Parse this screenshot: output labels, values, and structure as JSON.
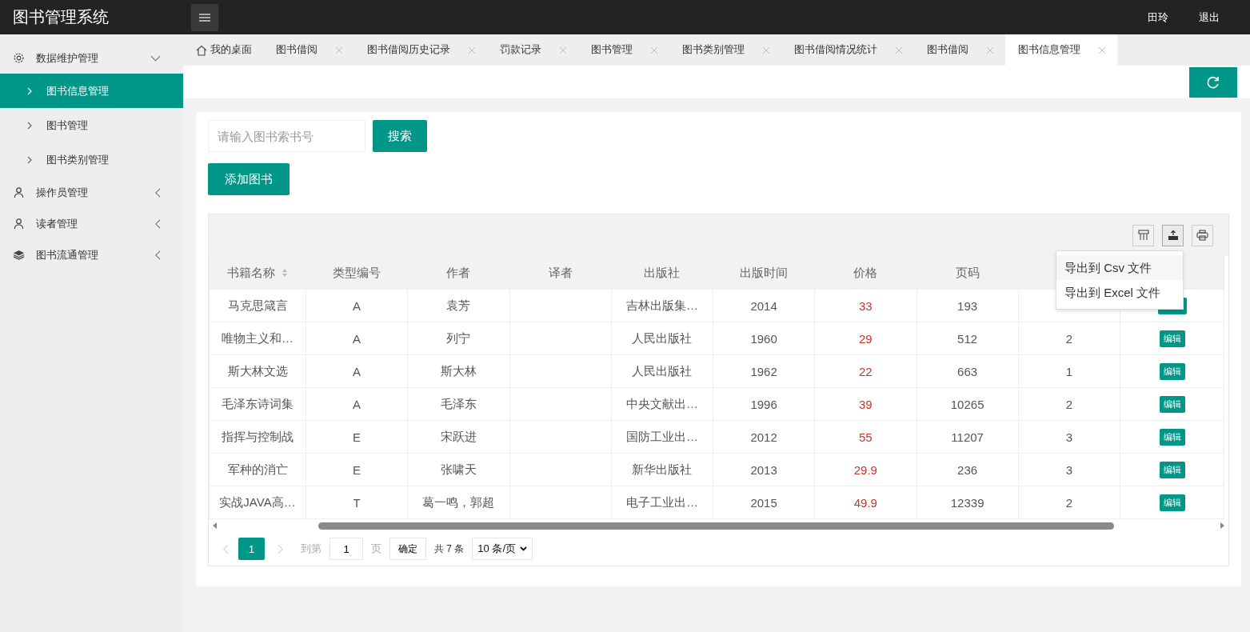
{
  "header": {
    "title": "图书管理系统",
    "user": "田玲",
    "logout": "退出"
  },
  "sidebar": {
    "items": [
      {
        "label": "数据维护管理",
        "expanded": true,
        "children": [
          {
            "label": "图书信息管理",
            "selected": true
          },
          {
            "label": "图书管理",
            "selected": false
          },
          {
            "label": "图书类别管理",
            "selected": false
          }
        ]
      },
      {
        "label": "操作员管理",
        "expanded": false
      },
      {
        "label": "读者管理",
        "expanded": false
      },
      {
        "label": "图书流通管理",
        "expanded": false
      }
    ]
  },
  "tabs": [
    {
      "label": "我的桌面",
      "kind": "home",
      "selected": false
    },
    {
      "label": "图书借阅",
      "kind": "page",
      "selected": false
    },
    {
      "label": "图书借阅历史记录",
      "kind": "page",
      "selected": false
    },
    {
      "label": "罚款记录",
      "kind": "page",
      "selected": false
    },
    {
      "label": "图书管理",
      "kind": "page",
      "selected": false
    },
    {
      "label": "图书类别管理",
      "kind": "page",
      "selected": false
    },
    {
      "label": "图书借阅情况统计",
      "kind": "page",
      "selected": false
    },
    {
      "label": "图书借阅",
      "kind": "page",
      "selected": false
    },
    {
      "label": "图书信息管理",
      "kind": "page",
      "selected": true
    }
  ],
  "search": {
    "placeholder": "请输入图书索书号",
    "button": "搜索"
  },
  "add_button": "添加图书",
  "export_menu": [
    "导出到 Csv 文件",
    "导出到 Excel 文件"
  ],
  "table": {
    "columns": [
      "书籍名称",
      "类型编号",
      "作者",
      "译者",
      "出版社",
      "出版时间",
      "价格",
      "页码"
    ],
    "rows": [
      {
        "cells": [
          "马克思箴言",
          "A",
          "袁芳",
          "",
          "吉林出版集…",
          "2014",
          "33",
          "193",
          ""
        ]
      },
      {
        "cells": [
          "唯物主义和…",
          "A",
          "列宁",
          "",
          "人民出版社",
          "1960",
          "29",
          "512",
          "2"
        ],
        "action": "编辑"
      },
      {
        "cells": [
          "斯大林文选",
          "A",
          "斯大林",
          "",
          "人民出版社",
          "1962",
          "22",
          "663",
          "1"
        ],
        "action": "编辑"
      },
      {
        "cells": [
          "毛泽东诗词集",
          "A",
          "毛泽东",
          "",
          "中央文献出…",
          "1996",
          "39",
          "10265",
          "2"
        ],
        "action": "编辑"
      },
      {
        "cells": [
          "指挥与控制战",
          "E",
          "宋跃进",
          "",
          "国防工业出…",
          "2012",
          "55",
          "11207",
          "3"
        ],
        "action": "编辑"
      },
      {
        "cells": [
          "军种的消亡",
          "E",
          "张啸天",
          "",
          "新华出版社",
          "2013",
          "29.9",
          "236",
          "3"
        ],
        "action": "编辑"
      },
      {
        "cells": [
          "实战JAVA高…",
          "T",
          "葛一鸣，郭超",
          "",
          "电子工业出…",
          "2015",
          "49.9",
          "12339",
          "2"
        ],
        "action": "编辑"
      }
    ]
  },
  "pagination": {
    "pages": [
      {
        "label": "1",
        "selected": true
      }
    ],
    "goto_label": "到第",
    "goto_value": "1",
    "page_unit": "页",
    "confirm": "确定",
    "total": "共 7 条",
    "page_size": "10 条/页"
  }
}
